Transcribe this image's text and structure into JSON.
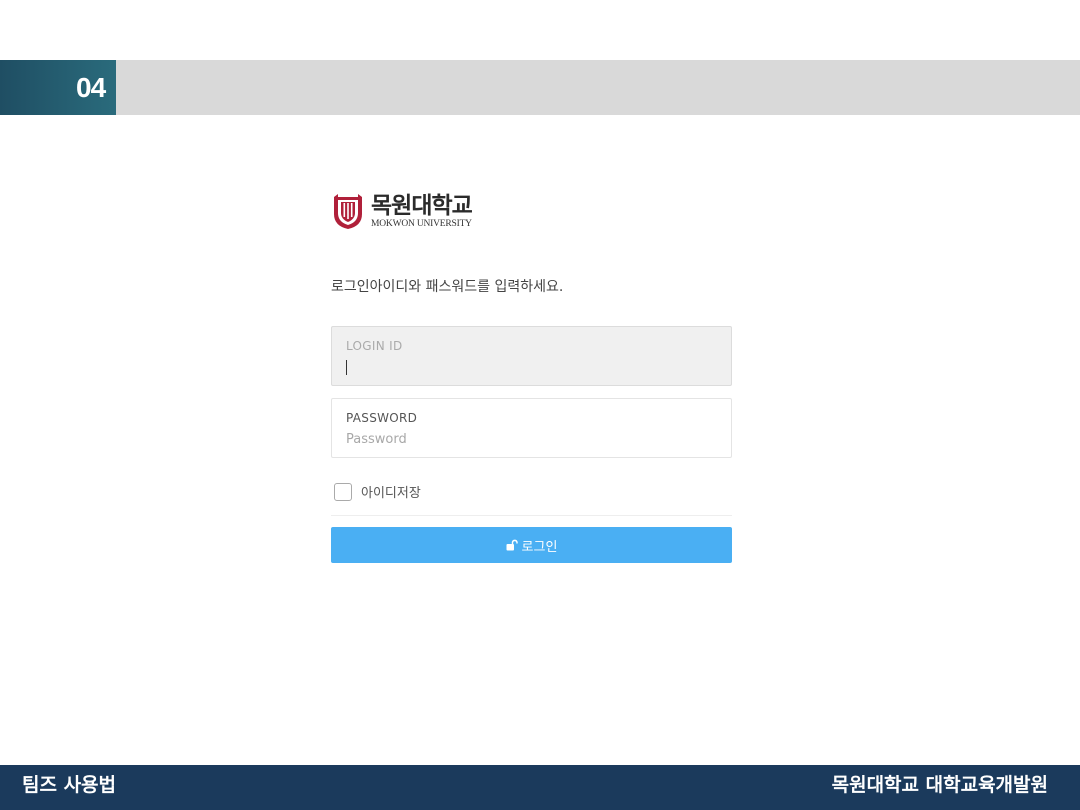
{
  "slide": {
    "number": "04"
  },
  "logo": {
    "korean": "목원대학교",
    "english": "MOKWON UNIVERSITY"
  },
  "login": {
    "instruction": "로그인아이디와 패스워드를 입력하세요.",
    "id_field": {
      "label": "LOGIN ID",
      "value": ""
    },
    "password_field": {
      "label": "PASSWORD",
      "placeholder": "Password"
    },
    "remember_label": "아이디저장",
    "button_label": "로그인",
    "button_color": "#4aaff3"
  },
  "footer": {
    "left": "팀즈 사용법",
    "right": "목원대학교 대학교육개발원"
  },
  "colors": {
    "footer_bg": "#1b3a5c",
    "header_band": "#d9d9d9",
    "slide_num_bg": "#1f4e63",
    "logo_red": "#b0203a"
  }
}
